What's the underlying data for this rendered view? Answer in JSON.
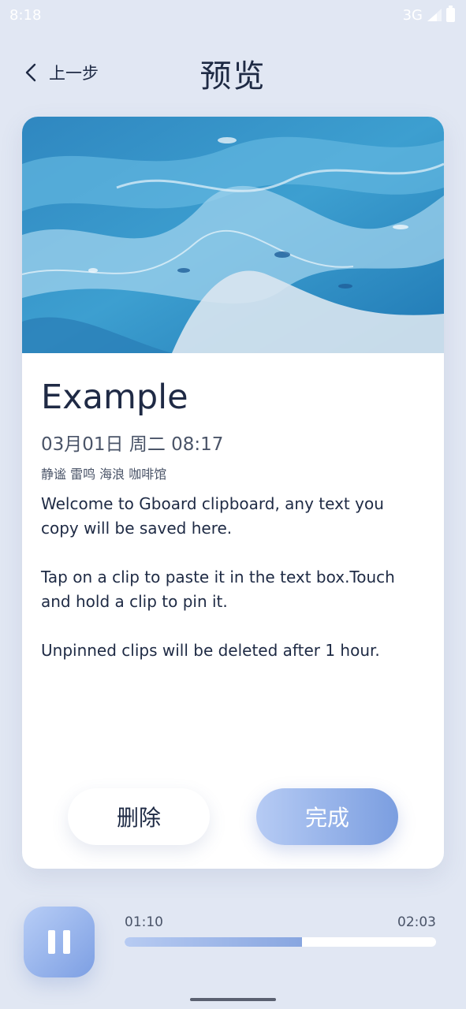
{
  "status_bar": {
    "time": "8:18",
    "network": "3G",
    "icons": [
      "signal-icon",
      "battery-icon"
    ]
  },
  "header": {
    "back_label": "上一步",
    "title": "预览",
    "icons": [
      "chevron-left-icon"
    ]
  },
  "card": {
    "image": "blue-marble-abstract-image",
    "title": "Example",
    "date": "03月01日 周二 08:17",
    "tags": "静谧 雷鸣 海浪 咖啡馆",
    "body": "Welcome to Gboard clipboard, any text you copy will be saved here.\n\nTap on a clip to paste it in the text box.Touch and hold a clip to pin it.\n\nUnpinned clips will be deleted after 1 hour."
  },
  "actions": {
    "delete_label": "删除",
    "done_label": "完成"
  },
  "player": {
    "current_time": "01:10",
    "total_time": "02:03",
    "progress": 0.57,
    "icons": [
      "pause-icon"
    ]
  },
  "colors": {
    "background": "#e1e7f3",
    "accent_start": "#b6cbf4",
    "accent_end": "#7b9ee0",
    "text": "#1e2a44"
  }
}
